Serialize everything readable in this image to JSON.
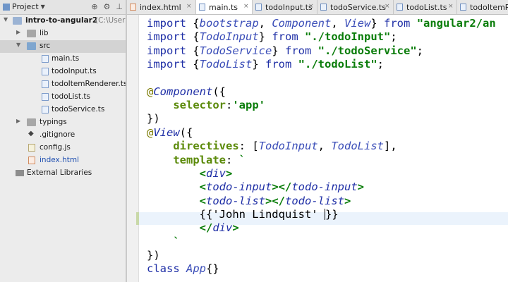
{
  "project_panel": {
    "title": "Project",
    "tools": {
      "target": "⊕",
      "settings": "⚙",
      "pin": "⊥"
    },
    "tree": [
      {
        "label": "intro-to-angular2",
        "suffix": "(C:\\Users\\",
        "kind": "root"
      },
      {
        "label": "lib",
        "kind": "folder"
      },
      {
        "label": "src",
        "kind": "folder"
      },
      {
        "label": "main.ts",
        "kind": "ts"
      },
      {
        "label": "todoInput.ts",
        "kind": "ts"
      },
      {
        "label": "todoItemRenderer.ts",
        "kind": "ts"
      },
      {
        "label": "todoList.ts",
        "kind": "ts"
      },
      {
        "label": "todoService.ts",
        "kind": "ts"
      },
      {
        "label": "typings",
        "kind": "folder"
      },
      {
        "label": ".gitignore",
        "kind": "git"
      },
      {
        "label": "config.js",
        "kind": "js"
      },
      {
        "label": "index.html",
        "kind": "html"
      },
      {
        "label": "External Libraries",
        "kind": "lib"
      }
    ]
  },
  "tabs": [
    {
      "label": "index.html",
      "type": "html",
      "active": false
    },
    {
      "label": "main.ts",
      "type": "ts",
      "active": true
    },
    {
      "label": "todoInput.ts",
      "type": "ts",
      "active": false
    },
    {
      "label": "todoService.ts",
      "type": "ts",
      "active": false
    },
    {
      "label": "todoList.ts",
      "type": "ts",
      "active": false
    },
    {
      "label": "todoItemR",
      "type": "ts",
      "active": false
    }
  ],
  "tab_close_glyph": "×",
  "code": [
    [
      [
        "kw",
        "import "
      ],
      [
        "plain",
        "{"
      ],
      [
        "id",
        "bootstrap"
      ],
      [
        "plain",
        ", "
      ],
      [
        "id",
        "Component"
      ],
      [
        "plain",
        ", "
      ],
      [
        "id",
        "View"
      ],
      [
        "plain",
        "} "
      ],
      [
        "kw",
        "from "
      ],
      [
        "str",
        "\"angular2/an"
      ]
    ],
    [
      [
        "kw",
        "import "
      ],
      [
        "plain",
        "{"
      ],
      [
        "id",
        "TodoInput"
      ],
      [
        "plain",
        "} "
      ],
      [
        "kw",
        "from "
      ],
      [
        "str",
        "\"./todoInput\""
      ],
      [
        "plain",
        ";"
      ]
    ],
    [
      [
        "kw",
        "import "
      ],
      [
        "plain",
        "{"
      ],
      [
        "id",
        "TodoService"
      ],
      [
        "plain",
        "} "
      ],
      [
        "kw",
        "from "
      ],
      [
        "str",
        "\"./todoService\""
      ],
      [
        "plain",
        ";"
      ]
    ],
    [
      [
        "kw",
        "import "
      ],
      [
        "plain",
        "{"
      ],
      [
        "id",
        "TodoList"
      ],
      [
        "plain",
        "} "
      ],
      [
        "kw",
        "from "
      ],
      [
        "str",
        "\"./todoList\""
      ],
      [
        "plain",
        ";"
      ]
    ],
    [],
    [
      [
        "dec",
        "@"
      ],
      [
        "decname",
        "Component"
      ],
      [
        "plain",
        "({"
      ]
    ],
    [
      [
        "plain",
        "    "
      ],
      [
        "prop",
        "selector"
      ],
      [
        "plain",
        ":"
      ],
      [
        "str",
        "'app'"
      ]
    ],
    [
      [
        "plain",
        "})"
      ]
    ],
    [
      [
        "dec",
        "@"
      ],
      [
        "decname",
        "View"
      ],
      [
        "plain",
        "({"
      ]
    ],
    [
      [
        "plain",
        "    "
      ],
      [
        "prop",
        "directives"
      ],
      [
        "plain",
        ": ["
      ],
      [
        "id",
        "TodoInput"
      ],
      [
        "plain",
        ", "
      ],
      [
        "id",
        "TodoList"
      ],
      [
        "plain",
        "],"
      ]
    ],
    [
      [
        "plain",
        "    "
      ],
      [
        "prop",
        "template"
      ],
      [
        "plain",
        ": "
      ],
      [
        "str",
        "`"
      ]
    ],
    [
      [
        "plain",
        "        "
      ],
      [
        "ang",
        "<"
      ],
      [
        "tag",
        "div"
      ],
      [
        "ang",
        ">"
      ]
    ],
    [
      [
        "plain",
        "        "
      ],
      [
        "ang",
        "<"
      ],
      [
        "tag",
        "todo-input"
      ],
      [
        "ang",
        "></"
      ],
      [
        "tag",
        "todo-input"
      ],
      [
        "ang",
        ">"
      ]
    ],
    [
      [
        "plain",
        "        "
      ],
      [
        "ang",
        "<"
      ],
      [
        "tag",
        "todo-list"
      ],
      [
        "ang",
        "></"
      ],
      [
        "tag",
        "todo-list"
      ],
      [
        "ang",
        ">"
      ]
    ],
    [
      [
        "plain",
        "        {{'John Lindquist' "
      ],
      [
        "caret",
        ""
      ],
      [
        "plain",
        "}}"
      ]
    ],
    [
      [
        "plain",
        "        "
      ],
      [
        "ang",
        "</"
      ],
      [
        "tag",
        "div"
      ],
      [
        "ang",
        ">"
      ]
    ],
    [
      [
        "plain",
        "    "
      ],
      [
        "str",
        "`"
      ]
    ],
    [
      [
        "plain",
        "})"
      ]
    ],
    [
      [
        "kw",
        "class "
      ],
      [
        "id",
        "App"
      ],
      [
        "plain",
        "{}"
      ]
    ]
  ]
}
